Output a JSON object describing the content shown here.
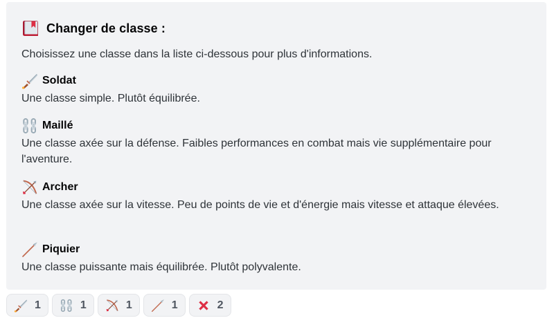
{
  "embed": {
    "title": "Changer de classe :",
    "title_icon": "book-icon",
    "description": "Choisissez une classe dans la liste ci-dessous pour plus d'informations.",
    "classes": [
      {
        "name": "Soldat",
        "icon": "dagger-icon",
        "text": "Une classe simple. Plutôt équilibrée."
      },
      {
        "name": "Maillé",
        "icon": "chains-icon",
        "text": "Une classe axée sur la défense. Faibles performances en combat mais vie supplémentaire pour l'aventure."
      },
      {
        "name": "Archer",
        "icon": "bow-and-arrow-icon",
        "text": "Une classe axée sur la vitesse. Peu de points de vie et d'énergie mais vitesse et attaque élevées."
      },
      {
        "name": "Piquier",
        "icon": "spear-icon",
        "text": "Une classe puissante mais équilibrée. Plutôt polyvalente."
      }
    ]
  },
  "reactions": [
    {
      "icon": "dagger-icon",
      "count": "1"
    },
    {
      "icon": "chains-icon",
      "count": "1"
    },
    {
      "icon": "bow-and-arrow-icon",
      "count": "1"
    },
    {
      "icon": "spear-icon",
      "count": "1"
    },
    {
      "icon": "cross-mark-icon",
      "count": "2"
    }
  ],
  "colors": {
    "embed_bg": "#f2f3f5",
    "title_text": "#060607",
    "body_text": "#2e3338",
    "cross_red": "#dd2e44"
  }
}
